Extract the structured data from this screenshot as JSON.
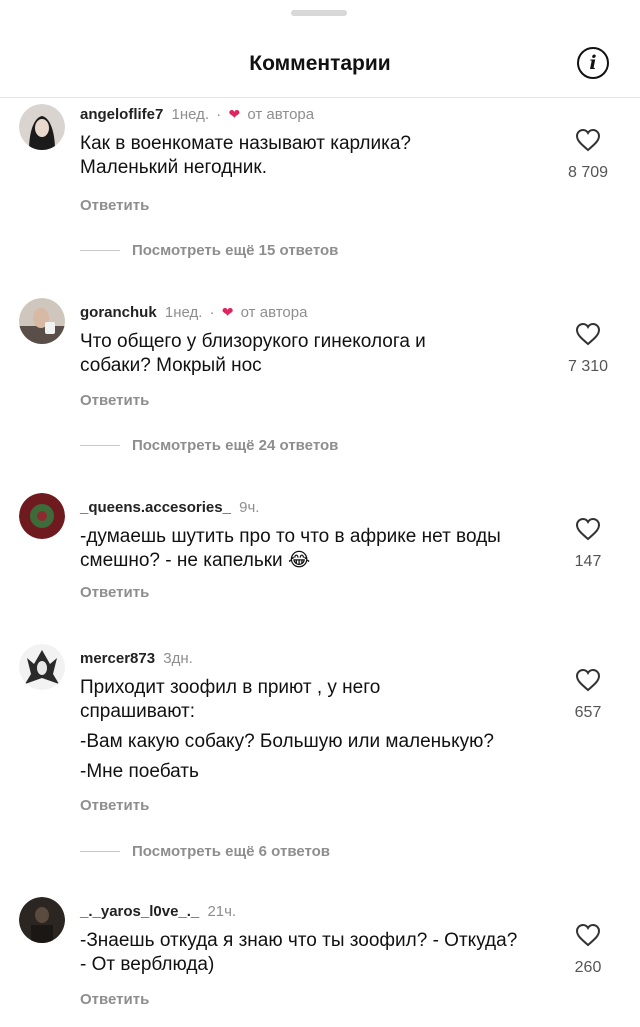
{
  "header": {
    "title": "Комментарии",
    "info_icon": "info-icon"
  },
  "labels": {
    "reply": "Ответить",
    "by_author": "от автора",
    "separator": "·"
  },
  "comments": [
    {
      "username": "angeloflife7",
      "time": "1нед.",
      "author_liked": true,
      "text": "Как в военкомате называют карлика? Маленький негодник.",
      "likes": "8 709",
      "more_replies": "Посмотреть ещё 15 ответов"
    },
    {
      "username": "goranchuk",
      "time": "1нед.",
      "author_liked": true,
      "text": "Что общего у близорукого гинеколога и собаки? Мокрый нос",
      "likes": "7 310",
      "more_replies": "Посмотреть ещё 24 ответов"
    },
    {
      "username": "_queens.accesories_",
      "time": "9ч.",
      "author_liked": false,
      "text": "-думаешь шутить про то что в африке нет воды смешно? - не капельки",
      "emoji": "😂",
      "likes": "147",
      "more_replies": ""
    },
    {
      "username": "mercer873",
      "time": "3дн.",
      "author_liked": false,
      "text_lines": [
        "Приходит зоофил в приют , у него",
        "спрашивают:",
        "-Вам какую собаку? Большую или маленькую?",
        "-Мне поебать"
      ],
      "likes": "657",
      "more_replies": "Посмотреть ещё 6 ответов"
    },
    {
      "username": "_._yaros_l0ve_._",
      "time": "21ч.",
      "author_liked": false,
      "text": "-Знаешь откуда я знаю что ты зоофил? - Откуда? - От верблюда)",
      "likes": "260",
      "more_replies": ""
    }
  ]
}
